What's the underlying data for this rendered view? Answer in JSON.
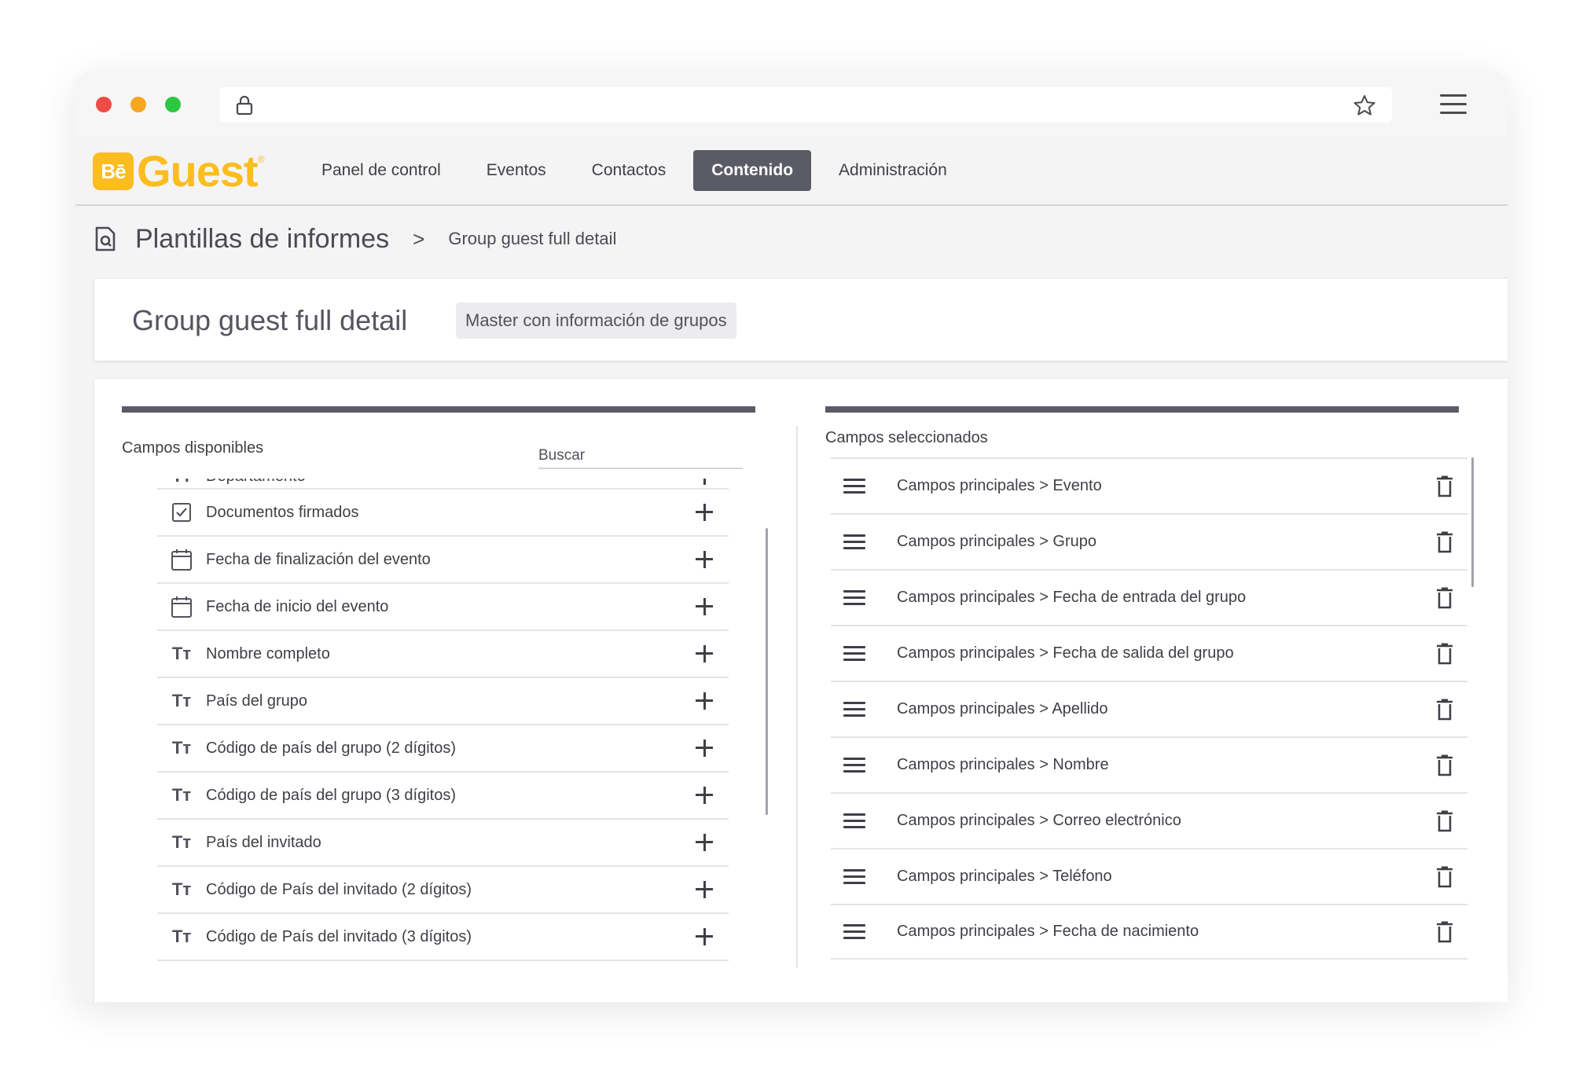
{
  "browser": {
    "url": ""
  },
  "logo": {
    "badge": "Bē",
    "text": "Guest",
    "reg": "®"
  },
  "nav": {
    "items": [
      {
        "label": "Panel de control"
      },
      {
        "label": "Eventos"
      },
      {
        "label": "Contactos"
      },
      {
        "label": "Contenido",
        "active": true
      },
      {
        "label": "Administración"
      }
    ]
  },
  "breadcrumb": {
    "title": "Plantillas de informes",
    "separator": ">",
    "current": "Group guest full detail"
  },
  "header": {
    "title": "Group guest full detail",
    "badge": "Master con información de grupos"
  },
  "available": {
    "label": "Campos disponibles",
    "search_placeholder": "Buscar",
    "partial_item": "Departamento",
    "items": [
      {
        "label": "Documentos firmados",
        "icon": "checkbox-icon"
      },
      {
        "label": "Fecha de finalización del evento",
        "icon": "calendar-icon"
      },
      {
        "label": "Fecha de inicio del evento",
        "icon": "calendar-icon"
      },
      {
        "label": "Nombre completo",
        "icon": "text-type-icon"
      },
      {
        "label": "País del grupo",
        "icon": "text-type-icon"
      },
      {
        "label": "Código de país del grupo (2 dígitos)",
        "icon": "text-type-icon"
      },
      {
        "label": "Código de país del grupo (3 dígitos)",
        "icon": "text-type-icon"
      },
      {
        "label": "País del invitado",
        "icon": "text-type-icon"
      },
      {
        "label": "Código de País del invitado (2 dígitos)",
        "icon": "text-type-icon"
      },
      {
        "label": "Código de País del invitado (3 dígitos)",
        "icon": "text-type-icon"
      }
    ]
  },
  "selected": {
    "label": "Campos seleccionados",
    "items": [
      {
        "label": "Campos principales > Evento"
      },
      {
        "label": "Campos principales > Grupo"
      },
      {
        "label": "Campos principales > Fecha de entrada del grupo"
      },
      {
        "label": "Campos principales > Fecha de salida del grupo"
      },
      {
        "label": "Campos principales > Apellido"
      },
      {
        "label": "Campos principales > Nombre"
      },
      {
        "label": "Campos principales > Correo electrónico"
      },
      {
        "label": "Campos principales > Teléfono"
      },
      {
        "label": "Campos principales > Fecha de nacimiento"
      }
    ]
  },
  "colors": {
    "brand": "#fbbd1f",
    "nav_active": "#5b5b66",
    "traffic_red": "#ee4b45",
    "traffic_yellow": "#f5a623",
    "traffic_green": "#2ec742"
  }
}
